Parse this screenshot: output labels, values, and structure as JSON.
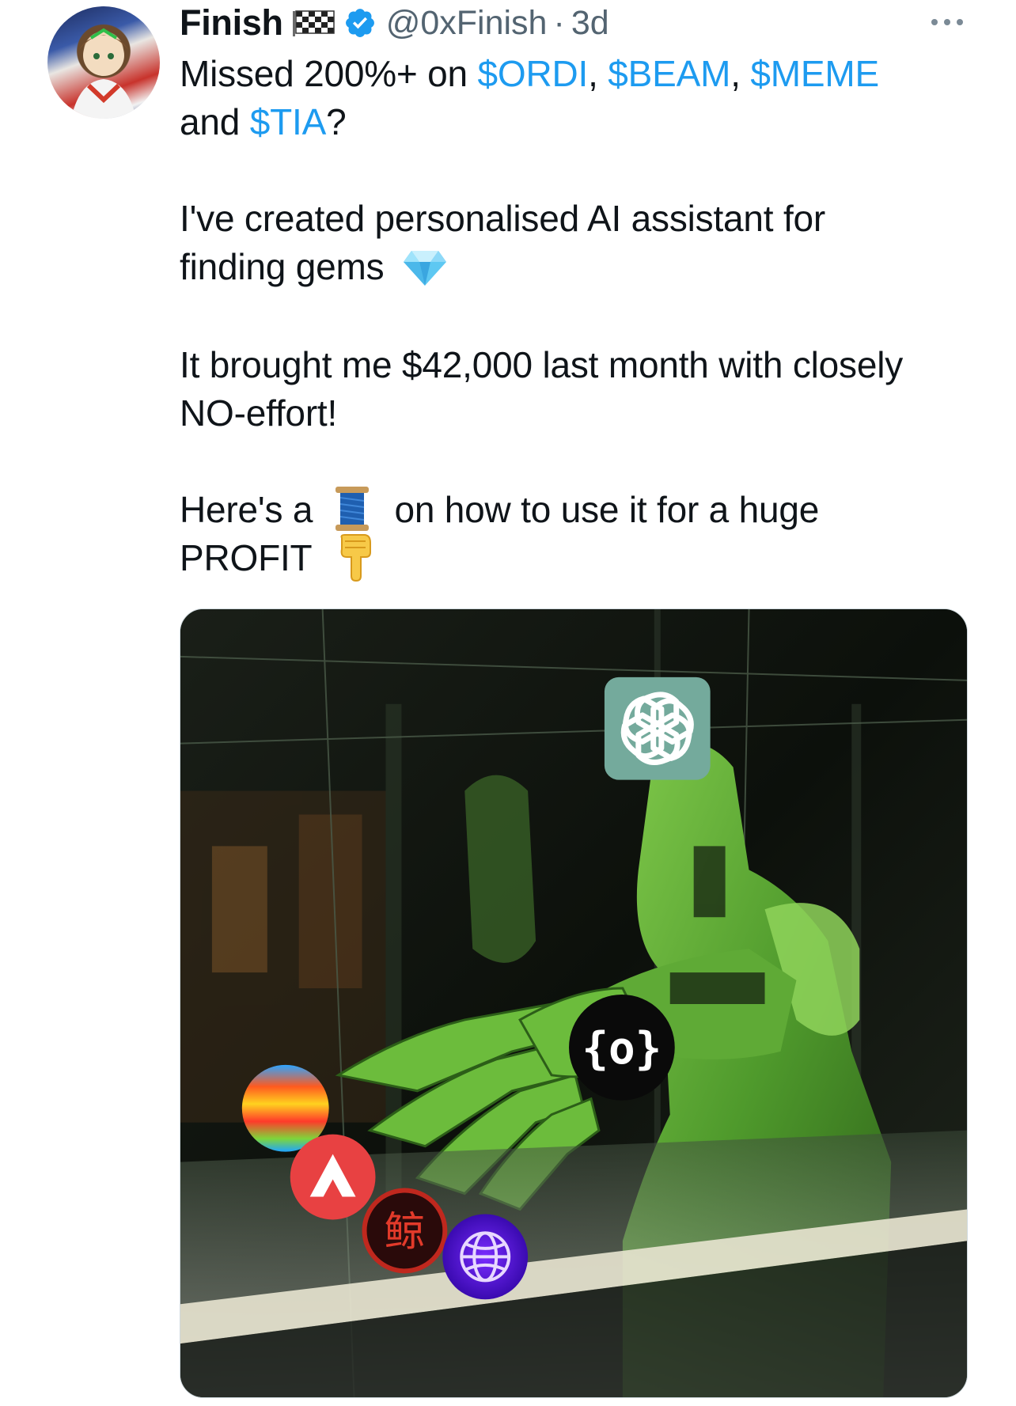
{
  "tweet": {
    "author": {
      "display_name": "Finish",
      "handle": "@0xFinish",
      "verified": true
    },
    "time": "3d",
    "separator": "·",
    "lines": {
      "l1_pre": "Missed 200%+ on ",
      "tag1": "$ORDI",
      "comma1": ", ",
      "tag2": "$BEAM",
      "comma2": ", ",
      "tag3": "$MEME",
      "l2_pre": "and ",
      "tag4": "$TIA",
      "l2_post": "?",
      "p2_l1": "I've created personalised AI assistant for",
      "p2_l2": "finding gems",
      "p3_l1": "It brought me $42,000 last month with closely",
      "p3_l2": "NO-effort!",
      "p4_l1_pre": "Here's a",
      "p4_l1_post": "on how to use it for a huge",
      "p4_l2": "PROFIT"
    },
    "media": {
      "badge_char": "鲸",
      "overlay_icon": "{o}"
    }
  },
  "icons": {
    "flag": "chequered-flag-icon",
    "verified": "verified-badge-icon",
    "more": "more-options-icon",
    "gem": "gem-stone-emoji-icon",
    "thread": "spool-of-thread-emoji-icon",
    "pointing": "backhand-index-pointing-down-emoji-icon"
  },
  "colors": {
    "link": "#1d9bf0",
    "secondary_text": "#536471",
    "verified": "#1d9bf0"
  }
}
